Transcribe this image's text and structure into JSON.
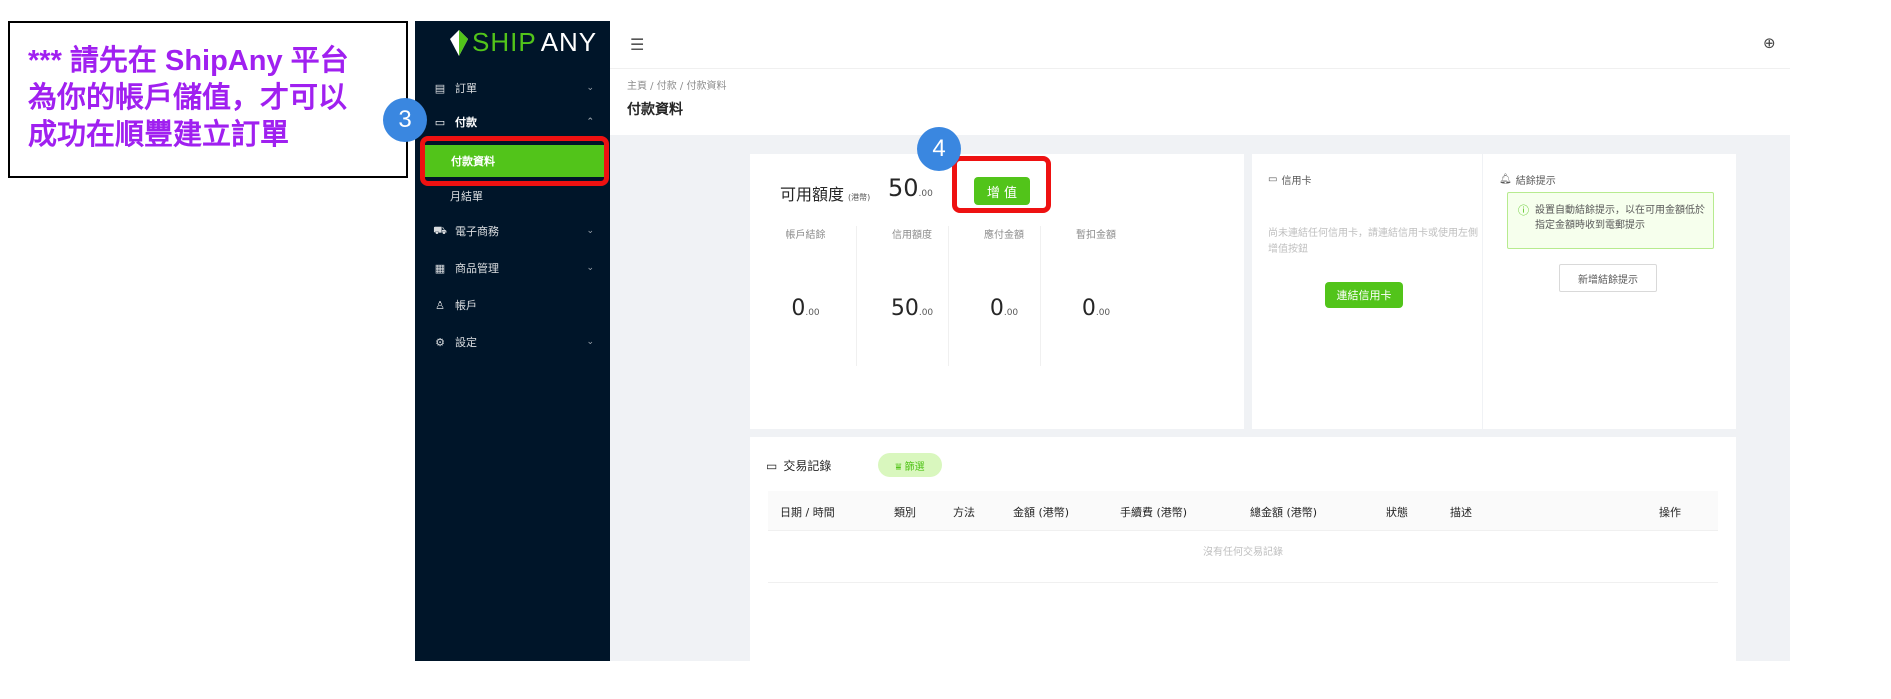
{
  "annotation": {
    "note": "*** 請先在 ShipAny 平台\n為你的帳戶儲值，才可以\n成功在順豐建立訂單",
    "step3": "3",
    "step4": "4"
  },
  "sidebar": {
    "logo_accent": "SHIP",
    "logo_rest": "ANY",
    "items": [
      {
        "label": "訂單",
        "icon": "order-icon"
      },
      {
        "label": "付款",
        "icon": "wallet-icon"
      },
      {
        "label": "電子商務",
        "icon": "cart-icon"
      },
      {
        "label": "商品管理",
        "icon": "grid-icon"
      },
      {
        "label": "帳戶",
        "icon": "user-icon"
      },
      {
        "label": "設定",
        "icon": "gear-icon"
      }
    ],
    "sub_items": [
      {
        "label": "付款資料"
      },
      {
        "label": "月結單"
      }
    ]
  },
  "header": {
    "breadcrumb": "主頁 / 付款 / 付款資料",
    "title": "付款資料"
  },
  "balance": {
    "label": "可用額度",
    "unit": "(港幣)",
    "amount_int": "50",
    "amount_dec": ".00",
    "topup_label": "增 值",
    "stats": [
      {
        "label": "帳戶結餘",
        "int": "0",
        "dec": ".00"
      },
      {
        "label": "信用額度",
        "int": "50",
        "dec": ".00"
      },
      {
        "label": "應付金額",
        "int": "0",
        "dec": ".00"
      },
      {
        "label": "暫扣金額",
        "int": "0",
        "dec": ".00"
      }
    ]
  },
  "credit_card": {
    "title": "信用卡",
    "desc": "尚未連結任何信用卡，請連結信用卡或使用左側增值按鈕",
    "link_label": "連結信用卡"
  },
  "reminder": {
    "title": "結餘提示",
    "alert": "設置自動結餘提示，以在可用金額低於指定金額時收到電郵提示",
    "add_label": "新增結餘提示"
  },
  "transactions": {
    "title": "交易記錄",
    "filter_label": "篩選",
    "columns": [
      "日期 / 時間",
      "類別",
      "方法",
      "金額 (港幣)",
      "手續費 (港幣)",
      "總金額 (港幣)",
      "狀態",
      "描述",
      "操作"
    ],
    "empty": "沒有任何交易記錄"
  },
  "colors": {
    "brand_green": "#52c41a",
    "sidebar_bg": "#001529",
    "highlight_red": "#ee1111",
    "badge_blue": "#3a87e0",
    "note_purple": "#a020f0"
  }
}
